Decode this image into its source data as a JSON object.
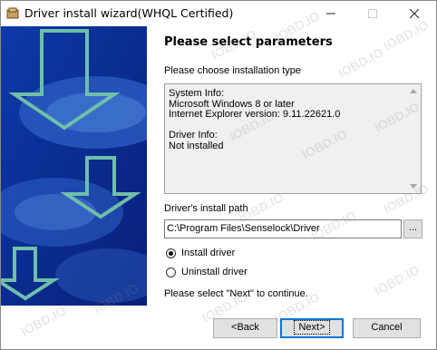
{
  "window": {
    "title": "Driver install wizard(WHQL Certified)"
  },
  "colors": {
    "banner_dark": "#0a2a8a",
    "banner_light": "#4a7ed6",
    "arrow": "#6fbfa9",
    "accent": "#0078d7"
  },
  "page": {
    "heading": "Please select parameters",
    "install_type_label": "Please choose installation type",
    "info_lines": "System Info:\nMicrosoft Windows 8 or later\nInternet Explorer version: 9.11.22621.0\n\nDriver Info:\nNot installed",
    "path_label": "Driver's install path",
    "path_value": "C:\\Program Files\\Senselock\\Driver",
    "browse_label": "...",
    "options": [
      {
        "label": "Install driver",
        "selected": true
      },
      {
        "label": "Uninstall driver",
        "selected": false
      }
    ],
    "hint": "Please select \"Next\" to continue."
  },
  "buttons": {
    "back": "<Back",
    "next": "Next>",
    "cancel": "Cancel"
  },
  "watermark": "IOBD.IO"
}
